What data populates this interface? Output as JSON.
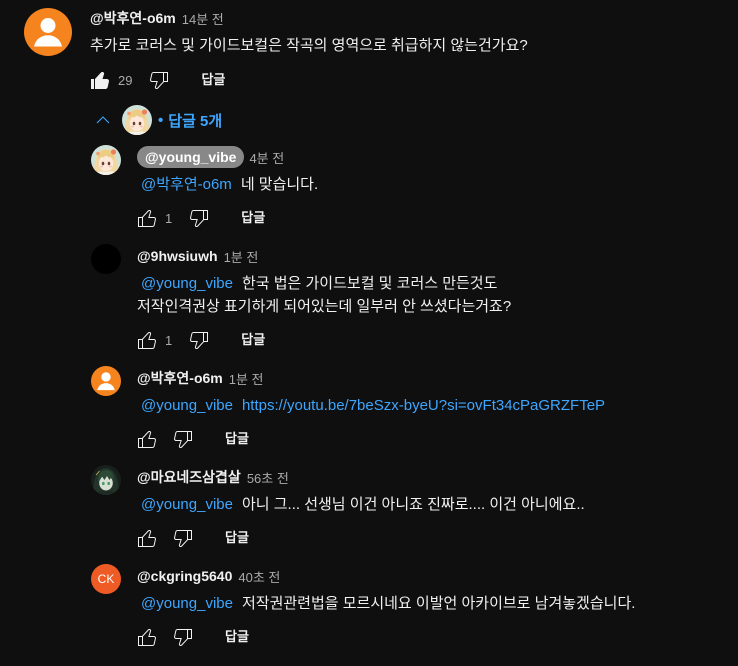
{
  "colors": {
    "background": "#0f0f0f",
    "text": "#f1f1f1",
    "secondary_text": "#aaaaaa",
    "link": "#3ea6ff",
    "owner_badge": "#888888",
    "avatar_orange": "#f5841f",
    "avatar_initials_bg": "#ef5b25",
    "avatar_black": "#000000"
  },
  "comment": {
    "avatar": "default-person-avatar",
    "author": "@박후연-o6m",
    "time": "14분 전",
    "text": "추가로 코러스 및 가이드보컬은 작곡의 영역으로 취급하지 않는건가요?",
    "like_icon": "thumbs-up-filled-icon",
    "like_count": "29",
    "dislike_icon": "thumbs-down-icon",
    "reply_label": "답글"
  },
  "replies_toggle": {
    "icon": "chevron-up-icon",
    "avatar": "profile-image-avatar",
    "bullet": "•",
    "label": "답글 5개"
  },
  "replies": [
    {
      "avatar": "profile-image-avatar",
      "author": "@young_vibe",
      "is_channel_owner": true,
      "time": "4분 전",
      "mention": "@박후연-o6m",
      "text": "네 맞습니다.",
      "like_count": "1",
      "reply_label": "답글"
    },
    {
      "avatar": "profile-image-avatar",
      "author": "@9hwsiuwh",
      "time": "1분 전",
      "mention": "@young_vibe",
      "text": "한국 법은 가이드보컬 및 코러스 만든것도\n저작인격권상 표기하게 되어있는데 일부러 안 쓰셨다는거죠?",
      "like_count": "1",
      "reply_label": "답글"
    },
    {
      "avatar": "default-person-avatar",
      "author": "@박후연-o6m",
      "time": "1분 전",
      "mention": "@young_vibe",
      "link": "https://youtu.be/7beSzx-byeU?si=ovFt34cPaGRZFTeP",
      "reply_label": "답글"
    },
    {
      "avatar": "profile-image-avatar",
      "author": "@마요네즈삼겹살",
      "time": "56초 전",
      "mention": "@young_vibe",
      "text": "아니 그... 선생님 이건 아니죠 진짜로.... 이건 아니에요..",
      "reply_label": "답글"
    },
    {
      "avatar": "initials-avatar",
      "avatar_initials": "CK",
      "author": "@ckgring5640",
      "time": "40초 전",
      "mention": "@young_vibe",
      "text": "저작권관련법을 모르시네요 이발언 아카이브로 남겨놓겠습니다.",
      "reply_label": "답글"
    }
  ]
}
